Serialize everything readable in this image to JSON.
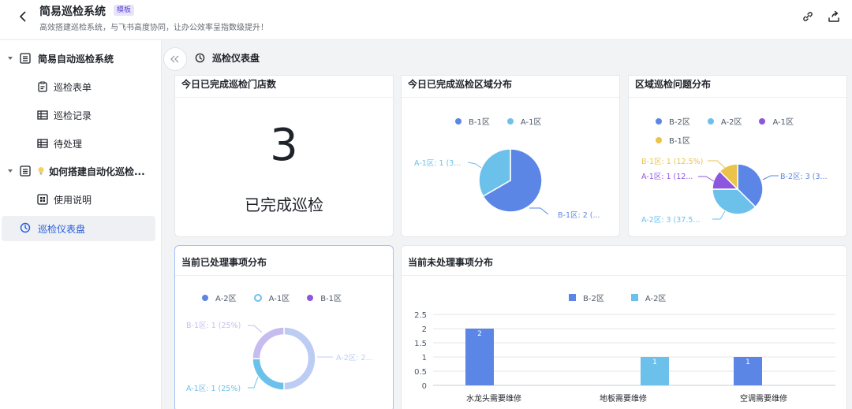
{
  "header": {
    "title": "简易巡检系统",
    "tag": "模板",
    "description": "高效搭建巡检系统，与飞书高度协同，让办公效率呈指数级提升！"
  },
  "sidebar": {
    "items": [
      {
        "label": "简易自动巡检系统"
      },
      {
        "label": "巡检表单"
      },
      {
        "label": "巡检记录"
      },
      {
        "label": "待处理"
      },
      {
        "label": "如何搭建自动化巡检..."
      },
      {
        "label": "使用说明"
      },
      {
        "label": "巡检仪表盘"
      }
    ]
  },
  "main": {
    "page_title": "巡检仪表盘"
  },
  "cards": {
    "stores_done": {
      "title": "今日已完成巡检门店数",
      "value": "3",
      "label": "已完成巡检"
    },
    "region_done": {
      "title": "今日已完成巡检区域分布"
    },
    "region_issues": {
      "title": "区域巡检问题分布"
    },
    "processed": {
      "title": "当前已处理事项分布"
    },
    "unprocessed": {
      "title": "当前未处理事项分布"
    }
  },
  "colors": {
    "blue": "#5b86e5",
    "light_blue": "#6cc1ea",
    "purple": "#8c56de",
    "yellow": "#ebc34b",
    "lavender": "#c7bcf0",
    "pale_blue": "#bcccf3",
    "accent": "#245bdb"
  },
  "chart_data": [
    {
      "type": "pie",
      "title": "今日已完成巡检区域分布",
      "legend": [
        "B-1区",
        "A-1区"
      ],
      "slices": [
        {
          "name": "B-1区",
          "value": 2,
          "label": "B-1区: 2 (..."
        },
        {
          "name": "A-1区",
          "value": 1,
          "label": "A-1区: 1 (3..."
        }
      ]
    },
    {
      "type": "pie",
      "title": "区域巡检问题分布",
      "legend": [
        "B-2区",
        "A-2区",
        "A-1区",
        "B-1区"
      ],
      "slices": [
        {
          "name": "B-2区",
          "value": 3,
          "label": "B-2区: 3 (3..."
        },
        {
          "name": "A-2区",
          "value": 3,
          "label": "A-2区: 3 (37.5..."
        },
        {
          "name": "A-1区",
          "value": 1,
          "label": "A-1区: 1 (12..."
        },
        {
          "name": "B-1区",
          "value": 1,
          "label": "B-1区: 1 (12.5%)"
        }
      ]
    },
    {
      "type": "pie",
      "title": "当前已处理事项分布",
      "legend": [
        "A-2区",
        "A-1区",
        "B-1区"
      ],
      "slices": [
        {
          "name": "A-2区",
          "value": 2,
          "label": "A-2区: 2..."
        },
        {
          "name": "A-1区",
          "value": 1,
          "label": "A-1区: 1 (25%)"
        },
        {
          "name": "B-1区",
          "value": 1,
          "label": "B-1区: 1 (25%)"
        }
      ]
    },
    {
      "type": "bar",
      "title": "当前未处理事项分布",
      "categories": [
        "水龙头需要维修",
        "地板需要维修",
        "空调需要维修"
      ],
      "series": [
        {
          "name": "B-2区",
          "values": [
            2,
            null,
            1
          ]
        },
        {
          "name": "A-2区",
          "values": [
            null,
            1,
            null
          ]
        }
      ],
      "yticks": [
        "0",
        "0.5",
        "1",
        "1.5",
        "2",
        "2.5"
      ],
      "ylim": [
        0,
        2.5
      ]
    }
  ]
}
